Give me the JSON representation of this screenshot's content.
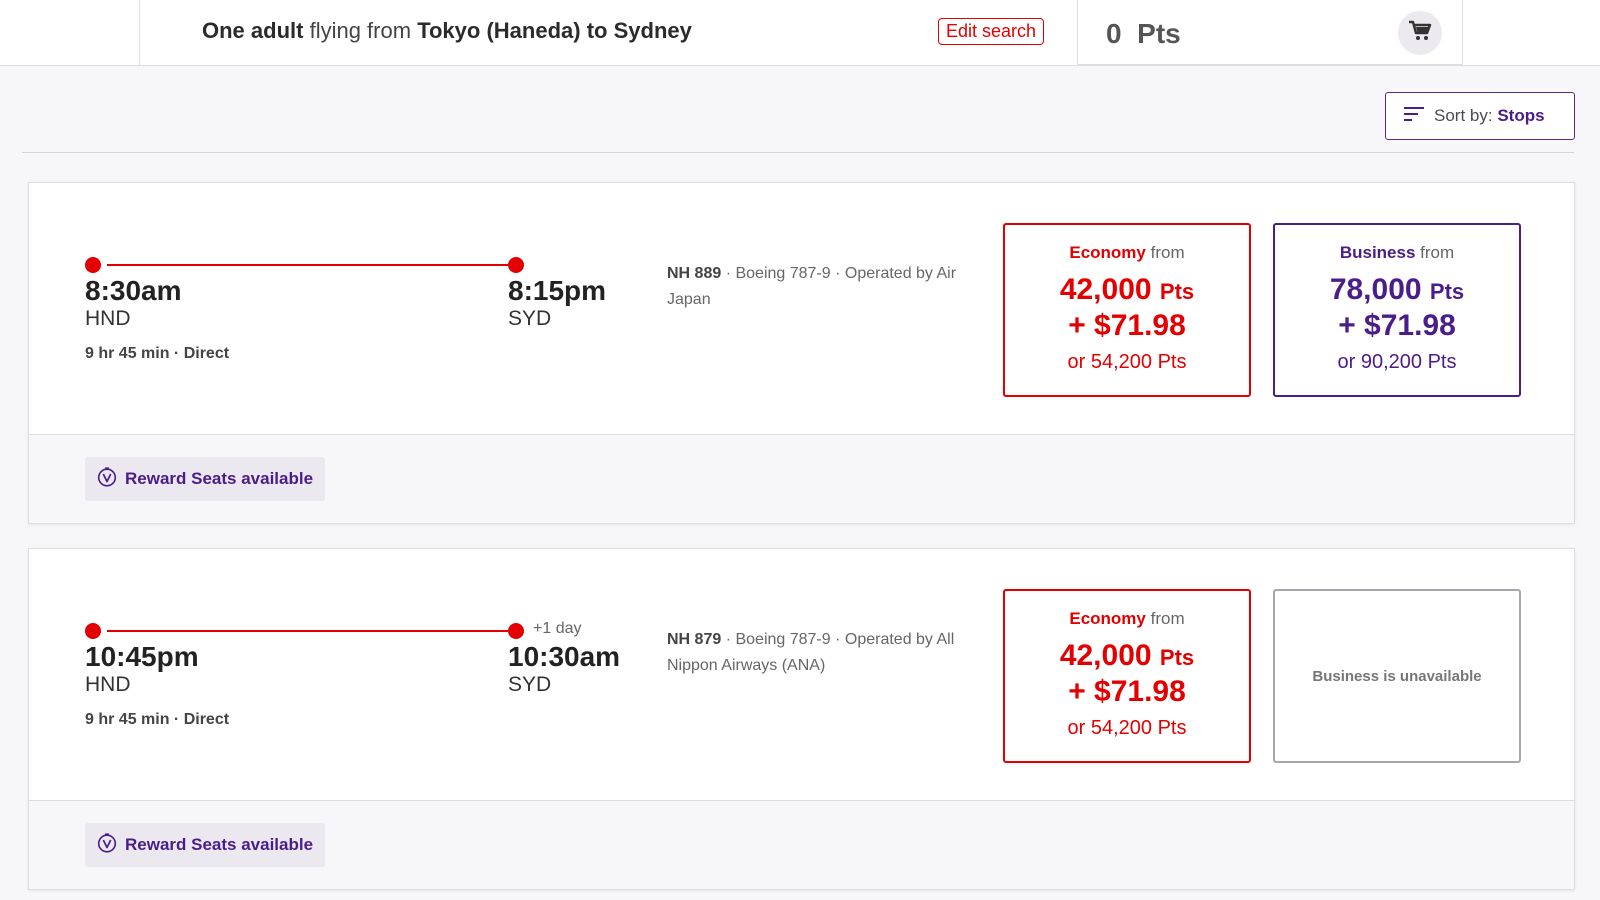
{
  "header": {
    "summary": {
      "travellers": "One adult",
      "flying_from": "flying from",
      "origin": "Tokyo (Haneda)",
      "to": "to",
      "destination": "Sydney"
    },
    "edit_search_label": "Edit search",
    "cart_points": "0",
    "cart_points_unit": "Pts",
    "cart_icon": "cart-icon"
  },
  "sort": {
    "label": "Sort by:",
    "value": "Stops",
    "icon": "sort-lines-icon"
  },
  "colors": {
    "accent_red": "#e40000",
    "accent_purple": "#4b1d8a"
  },
  "flights": [
    {
      "dep_time": "8:30am",
      "dep_airport": "HND",
      "arr_time": "8:15pm",
      "arr_airport": "SYD",
      "plus_day": "",
      "duration": "9 hr 45 min",
      "stops": "Direct",
      "flight_number": "NH 889",
      "aircraft": "Boeing 787-9",
      "operated_by_label": "Operated by",
      "operator": "Air Japan",
      "economy": {
        "cabin": "Economy",
        "from": "from",
        "points": "42,000",
        "pts_unit": "Pts",
        "cash": "+ $71.98",
        "alt": "or 54,200 Pts"
      },
      "business": {
        "available": true,
        "cabin": "Business",
        "from": "from",
        "points": "78,000",
        "pts_unit": "Pts",
        "cash": "+ $71.98",
        "alt": "or 90,200 Pts"
      },
      "reward_label": "Reward Seats available"
    },
    {
      "dep_time": "10:45pm",
      "dep_airport": "HND",
      "arr_time": "10:30am",
      "arr_airport": "SYD",
      "plus_day": "+1 day",
      "duration": "9 hr 45 min",
      "stops": "Direct",
      "flight_number": "NH 879",
      "aircraft": "Boeing 787-9",
      "operated_by_label": "Operated by",
      "operator": "All Nippon Airways (ANA)",
      "economy": {
        "cabin": "Economy",
        "from": "from",
        "points": "42,000",
        "pts_unit": "Pts",
        "cash": "+ $71.98",
        "alt": "or 54,200 Pts"
      },
      "business": {
        "available": false,
        "unavailable_text": "Business is unavailable"
      },
      "reward_label": "Reward Seats available"
    }
  ]
}
